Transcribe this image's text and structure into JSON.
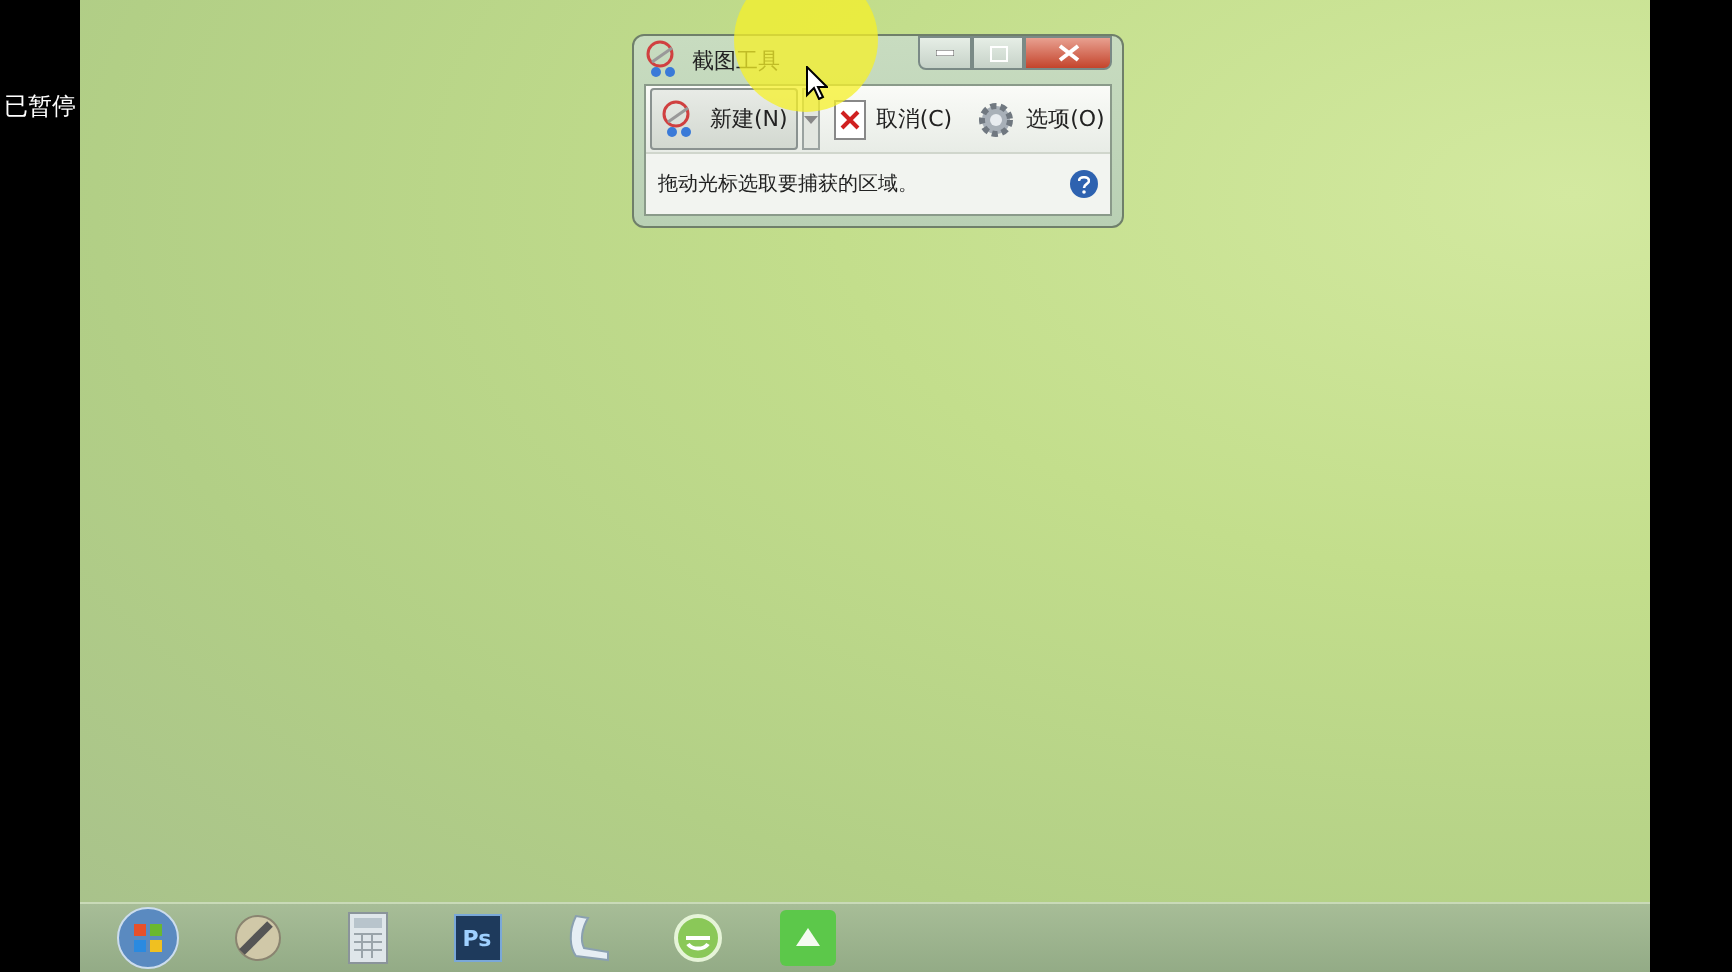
{
  "player": {
    "status": "已暂停"
  },
  "window": {
    "title": "截图工具",
    "toolbar": [
      {
        "kind": "new",
        "label": "新建(N)",
        "selected": true
      },
      {
        "kind": "cancel",
        "label": "取消(C)",
        "selected": false
      },
      {
        "kind": "options",
        "label": "选项(O)",
        "selected": false
      }
    ],
    "message": "拖动光标选取要捕获的区域。"
  },
  "taskbar": {
    "apps": [
      {
        "kind": "start"
      },
      {
        "kind": "media"
      },
      {
        "kind": "calculator"
      },
      {
        "kind": "photoshop",
        "label": "Ps"
      },
      {
        "kind": "scanner"
      },
      {
        "kind": "browser"
      },
      {
        "kind": "green-app"
      }
    ]
  }
}
